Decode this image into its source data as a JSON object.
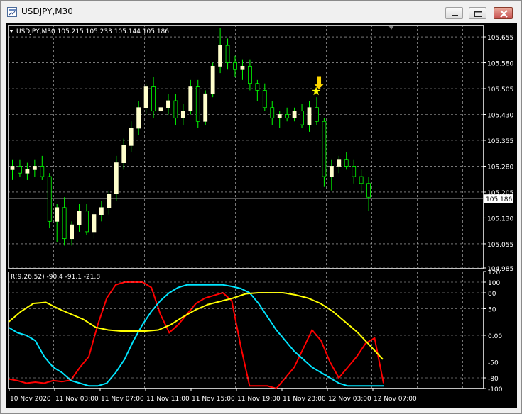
{
  "window": {
    "title": "USDJPY,M30",
    "icons": [
      "chart-window-icon",
      "minimize-icon",
      "maximize-icon",
      "close-icon"
    ]
  },
  "chart_data": [
    {
      "type": "candlestick",
      "header": "USDJPY,M30  105.215 105.233 105.144 105.186",
      "y_ticks": [
        "105.655",
        "105.580",
        "105.505",
        "105.430",
        "105.355",
        "105.280",
        "105.205",
        "105.130",
        "105.055",
        "104.985"
      ],
      "ylim": [
        104.985,
        105.69
      ],
      "current_price": "105.186",
      "colors": {
        "background": "#000000",
        "bull_body": "#ffffcc",
        "candle": "#00ff00",
        "grid": "#c0c0c0",
        "text": "#ffffff",
        "price_label_bg": "#ffffff"
      },
      "markers": [
        {
          "name": "star-icon",
          "symbol": "★",
          "color": "#ffff00",
          "candle": 41
        },
        {
          "name": "down-arrow-icon",
          "symbol": "⬇",
          "color": "#ffd700",
          "candle": 41
        }
      ],
      "candles": [
        [
          105.27,
          105.3,
          105.24,
          105.28
        ],
        [
          105.28,
          105.3,
          105.25,
          105.26
        ],
        [
          105.26,
          105.29,
          105.24,
          105.27
        ],
        [
          105.27,
          105.3,
          105.25,
          105.28
        ],
        [
          105.28,
          105.31,
          105.24,
          105.25
        ],
        [
          105.25,
          105.26,
          105.1,
          105.12
        ],
        [
          105.12,
          105.17,
          105.06,
          105.16
        ],
        [
          105.16,
          105.19,
          105.05,
          105.07
        ],
        [
          105.07,
          105.12,
          105.05,
          105.11
        ],
        [
          105.11,
          105.17,
          105.09,
          105.15
        ],
        [
          105.15,
          105.17,
          105.08,
          105.09
        ],
        [
          105.09,
          105.15,
          105.07,
          105.14
        ],
        [
          105.14,
          105.18,
          105.12,
          105.16
        ],
        [
          105.16,
          105.21,
          105.14,
          105.2
        ],
        [
          105.2,
          105.31,
          105.18,
          105.29
        ],
        [
          105.29,
          105.36,
          105.27,
          105.34
        ],
        [
          105.34,
          105.41,
          105.32,
          105.39
        ],
        [
          105.39,
          105.47,
          105.37,
          105.45
        ],
        [
          105.45,
          105.52,
          105.43,
          105.51
        ],
        [
          105.51,
          105.54,
          105.42,
          105.44
        ],
        [
          105.44,
          105.47,
          105.4,
          105.45
        ],
        [
          105.45,
          105.49,
          105.43,
          105.47
        ],
        [
          105.47,
          105.49,
          105.4,
          105.42
        ],
        [
          105.42,
          105.46,
          105.4,
          105.44
        ],
        [
          105.44,
          105.53,
          105.43,
          105.51
        ],
        [
          105.51,
          105.53,
          105.39,
          105.41
        ],
        [
          105.41,
          105.5,
          105.4,
          105.49
        ],
        [
          105.49,
          105.58,
          105.48,
          105.57
        ],
        [
          105.57,
          105.68,
          105.55,
          105.63
        ],
        [
          105.63,
          105.65,
          105.56,
          105.58
        ],
        [
          105.58,
          105.6,
          105.54,
          105.56
        ],
        [
          105.56,
          105.59,
          105.53,
          105.57
        ],
        [
          105.57,
          105.59,
          105.5,
          105.52
        ],
        [
          105.52,
          105.53,
          105.47,
          105.5
        ],
        [
          105.5,
          105.52,
          105.44,
          105.45
        ],
        [
          105.45,
          105.47,
          105.4,
          105.42
        ],
        [
          105.42,
          105.44,
          105.39,
          105.43
        ],
        [
          105.43,
          105.45,
          105.41,
          105.42
        ],
        [
          105.42,
          105.45,
          105.41,
          105.44
        ],
        [
          105.44,
          105.46,
          105.39,
          105.4
        ],
        [
          105.4,
          105.47,
          105.38,
          105.45
        ],
        [
          105.45,
          105.48,
          105.4,
          105.41
        ],
        [
          105.41,
          105.42,
          105.22,
          105.25
        ],
        [
          105.25,
          105.3,
          105.21,
          105.28
        ],
        [
          105.28,
          105.31,
          105.26,
          105.3
        ],
        [
          105.3,
          105.32,
          105.27,
          105.28
        ],
        [
          105.28,
          105.3,
          105.23,
          105.25
        ],
        [
          105.25,
          105.27,
          105.2,
          105.23
        ],
        [
          105.23,
          105.25,
          105.15,
          105.19
        ]
      ]
    },
    {
      "type": "line",
      "header": "R(9,26,52) -90.4 -91.1 -21.8",
      "y_ticks": [
        "120",
        "100",
        "80",
        "50",
        "0.00",
        "-50",
        "-80",
        "-100"
      ],
      "ylim": [
        -100,
        120
      ],
      "series": [
        {
          "color": "#ff0000",
          "values": [
            -82,
            -85,
            -90,
            -88,
            -90,
            -85,
            -87,
            -84,
            -60,
            -40,
            20,
            70,
            95,
            100,
            100,
            100,
            90,
            40,
            5,
            20,
            40,
            60,
            70,
            75,
            80,
            65,
            -20,
            -95,
            -95,
            -95,
            -100,
            -80,
            -60,
            -25,
            10,
            -10,
            -50,
            -80,
            -60,
            -40,
            -15,
            -5,
            -90
          ]
        },
        {
          "color": "#00e5ff",
          "values": [
            15,
            5,
            0,
            -10,
            -40,
            -60,
            -70,
            -85,
            -90,
            -95,
            -95,
            -90,
            -70,
            -45,
            -10,
            20,
            45,
            65,
            80,
            90,
            95,
            95,
            95,
            95,
            95,
            92,
            88,
            80,
            60,
            35,
            10,
            -10,
            -30,
            -45,
            -60,
            -70,
            -80,
            -90,
            -95,
            -95,
            -95,
            -95,
            -95
          ]
        },
        {
          "color": "#ffff00",
          "values": [
            25,
            45,
            60,
            62,
            50,
            40,
            30,
            15,
            10,
            8,
            8,
            8,
            10,
            20,
            35,
            48,
            58,
            64,
            70,
            78,
            80,
            80,
            80,
            76,
            70,
            60,
            45,
            25,
            5,
            -20,
            -45
          ]
        }
      ]
    }
  ],
  "x_axis": [
    "10 Nov 2020",
    "11 Nov 03:00",
    "11 Nov 07:00",
    "11 Nov 11:00",
    "11 Nov 15:00",
    "11 Nov 19:00",
    "11 Nov 23:00",
    "12 Nov 03:00",
    "12 Nov 07:00"
  ]
}
